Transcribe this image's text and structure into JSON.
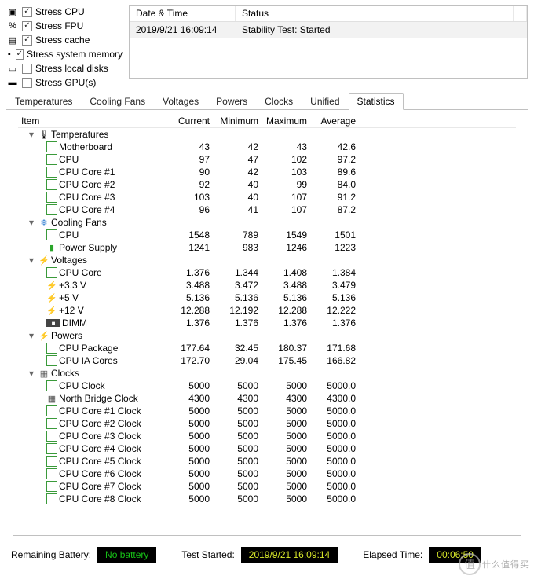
{
  "stress": [
    {
      "label": "Stress CPU",
      "checked": true,
      "icon": "chip"
    },
    {
      "label": "Stress FPU",
      "checked": true,
      "icon": "fpu"
    },
    {
      "label": "Stress cache",
      "checked": true,
      "icon": "cache"
    },
    {
      "label": "Stress system memory",
      "checked": true,
      "icon": "mem"
    },
    {
      "label": "Stress local disks",
      "checked": false,
      "icon": "disk"
    },
    {
      "label": "Stress GPU(s)",
      "checked": false,
      "icon": "gpu"
    }
  ],
  "status": {
    "head_datetime": "Date & Time",
    "head_status": "Status",
    "row_datetime": "2019/9/21 16:09:14",
    "row_status": "Stability Test: Started"
  },
  "tabs": [
    "Temperatures",
    "Cooling Fans",
    "Voltages",
    "Powers",
    "Clocks",
    "Unified",
    "Statistics"
  ],
  "active_tab": 6,
  "grid": {
    "headers": {
      "item": "Item",
      "cur": "Current",
      "min": "Minimum",
      "max": "Maximum",
      "avg": "Average"
    },
    "groups": [
      {
        "name": "Temperatures",
        "icon": "temp",
        "rows": [
          {
            "name": "Motherboard",
            "icon": "chip",
            "cur": "43",
            "min": "42",
            "max": "43",
            "avg": "42.6"
          },
          {
            "name": "CPU",
            "icon": "chip",
            "cur": "97",
            "min": "47",
            "max": "102",
            "avg": "97.2"
          },
          {
            "name": "CPU Core #1",
            "icon": "chip",
            "cur": "90",
            "min": "42",
            "max": "103",
            "avg": "89.6"
          },
          {
            "name": "CPU Core #2",
            "icon": "chip",
            "cur": "92",
            "min": "40",
            "max": "99",
            "avg": "84.0"
          },
          {
            "name": "CPU Core #3",
            "icon": "chip",
            "cur": "103",
            "min": "40",
            "max": "107",
            "avg": "91.2"
          },
          {
            "name": "CPU Core #4",
            "icon": "chip",
            "cur": "96",
            "min": "41",
            "max": "107",
            "avg": "87.2"
          }
        ]
      },
      {
        "name": "Cooling Fans",
        "icon": "fan",
        "rows": [
          {
            "name": "CPU",
            "icon": "chip",
            "cur": "1548",
            "min": "789",
            "max": "1549",
            "avg": "1501"
          },
          {
            "name": "Power Supply",
            "icon": "bat",
            "cur": "1241",
            "min": "983",
            "max": "1246",
            "avg": "1223"
          }
        ]
      },
      {
        "name": "Voltages",
        "icon": "volt",
        "rows": [
          {
            "name": "CPU Core",
            "icon": "chip",
            "cur": "1.376",
            "min": "1.344",
            "max": "1.408",
            "avg": "1.384"
          },
          {
            "name": "+3.3 V",
            "icon": "volt",
            "cur": "3.488",
            "min": "3.472",
            "max": "3.488",
            "avg": "3.479"
          },
          {
            "name": "+5 V",
            "icon": "volt",
            "cur": "5.136",
            "min": "5.136",
            "max": "5.136",
            "avg": "5.136"
          },
          {
            "name": "+12 V",
            "icon": "volt",
            "cur": "12.288",
            "min": "12.192",
            "max": "12.288",
            "avg": "12.222"
          },
          {
            "name": "DIMM",
            "icon": "dimm",
            "cur": "1.376",
            "min": "1.376",
            "max": "1.376",
            "avg": "1.376"
          }
        ]
      },
      {
        "name": "Powers",
        "icon": "pow",
        "rows": [
          {
            "name": "CPU Package",
            "icon": "chip",
            "cur": "177.64",
            "min": "32.45",
            "max": "180.37",
            "avg": "171.68"
          },
          {
            "name": "CPU IA Cores",
            "icon": "chip",
            "cur": "172.70",
            "min": "29.04",
            "max": "175.45",
            "avg": "166.82"
          }
        ]
      },
      {
        "name": "Clocks",
        "icon": "clk",
        "rows": [
          {
            "name": "CPU Clock",
            "icon": "chip",
            "cur": "5000",
            "min": "5000",
            "max": "5000",
            "avg": "5000.0"
          },
          {
            "name": "North Bridge Clock",
            "icon": "clk",
            "cur": "4300",
            "min": "4300",
            "max": "4300",
            "avg": "4300.0"
          },
          {
            "name": "CPU Core #1 Clock",
            "icon": "chip",
            "cur": "5000",
            "min": "5000",
            "max": "5000",
            "avg": "5000.0"
          },
          {
            "name": "CPU Core #2 Clock",
            "icon": "chip",
            "cur": "5000",
            "min": "5000",
            "max": "5000",
            "avg": "5000.0"
          },
          {
            "name": "CPU Core #3 Clock",
            "icon": "chip",
            "cur": "5000",
            "min": "5000",
            "max": "5000",
            "avg": "5000.0"
          },
          {
            "name": "CPU Core #4 Clock",
            "icon": "chip",
            "cur": "5000",
            "min": "5000",
            "max": "5000",
            "avg": "5000.0"
          },
          {
            "name": "CPU Core #5 Clock",
            "icon": "chip",
            "cur": "5000",
            "min": "5000",
            "max": "5000",
            "avg": "5000.0"
          },
          {
            "name": "CPU Core #6 Clock",
            "icon": "chip",
            "cur": "5000",
            "min": "5000",
            "max": "5000",
            "avg": "5000.0"
          },
          {
            "name": "CPU Core #7 Clock",
            "icon": "chip",
            "cur": "5000",
            "min": "5000",
            "max": "5000",
            "avg": "5000.0"
          },
          {
            "name": "CPU Core #8 Clock",
            "icon": "chip",
            "cur": "5000",
            "min": "5000",
            "max": "5000",
            "avg": "5000.0"
          }
        ]
      }
    ]
  },
  "statusbar": {
    "battery_label": "Remaining Battery:",
    "battery_value": "No battery",
    "started_label": "Test Started:",
    "started_value": "2019/9/21 16:09:14",
    "elapsed_label": "Elapsed Time:",
    "elapsed_value": "00:06:50"
  },
  "watermark": {
    "glyph": "值",
    "text": "什么值得买"
  }
}
